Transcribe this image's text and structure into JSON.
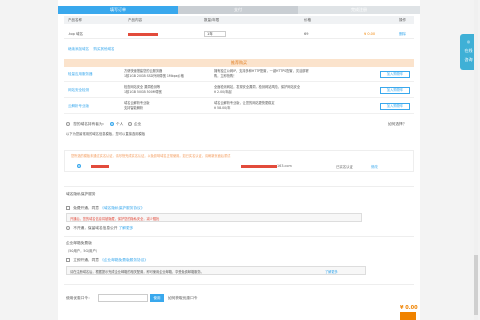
{
  "steps": [
    "填写订单",
    "支付",
    "完成注册"
  ],
  "table": {
    "headers": [
      "产品名称",
      "产品内容",
      "数量/年限",
      "价格",
      "操作"
    ],
    "row": {
      "name": ".top 域名",
      "years": "1年",
      "price": "¥ 0.00",
      "old_price": "69",
      "delete": "删除"
    }
  },
  "links": {
    "left": "继续添加域名",
    "right": "购买其他域名"
  },
  "recommend": {
    "title": "推荐购买",
    "items": [
      {
        "name": "轻量应用服务器",
        "desc1": "方便快速搭建您的云服务器",
        "desc2": "1核1GB 20GB SSD外网带宽 1Mbps价格",
        "desc3": "拥有独立公网IP，支持多种HTTP配置，一键HTTPS配置，灵活部署",
        "desc4": "购，立即抢购！",
        "btn": "加入购物车"
      },
      {
        "name": "网站安全检测",
        "desc1": "检查网站安全 漏洞检测等",
        "desc2": "1核1GB 50GB 500M带宽",
        "desc3": "全面检测网站，发现安全漏洞，检测网站风险，保护网站安全",
        "desc4": "¥ 2.00/年起",
        "btn": "加入购物车"
      },
      {
        "name": "云解析专业版",
        "desc1": "域名云解析专业版",
        "desc2": "支持智能解析",
        "desc3": "域名云解析专业版，让您的网站更快更稳定",
        "desc4": "¥ 58.00/年",
        "btn": "加入购物车"
      }
    ]
  },
  "owner": {
    "label": "您的域名持有者为：",
    "person": "个人",
    "company": "企业",
    "help": "如何选择？",
    "hint": "以下为您最常用的域名信息模板，您可以直接选用模板"
  },
  "notice": {
    "warn": "您所选的模板未通过实名认证，请尽快完成实名认证，以免影响域名正常使用。如已实名认证，请刷新页面后重试",
    "domain": "163.com",
    "status": "已实名认证",
    "action": "修改"
  },
  "privacy": {
    "title": "域名隐私保护服务",
    "option1_pre": "免费开通，同意",
    "option1_link": "《域名隐私保护服务协议》",
    "option1_desc": "开通后，您的域名信息将被隐藏，保护您的隐私安全，减少骚扰",
    "option2": "不开通，保留域名信息公开",
    "learn_more": "了解更多"
  },
  "email": {
    "title": "企业邮箱免费版",
    "sub": "（50用户，5G/用户）",
    "option_pre": "立即开通，同意",
    "option_link": "《企业邮箱免费版服务协议》",
    "desc": "请在注册域名后，根据提示完成企业邮箱的相关配置，即可使用企业邮箱，享受免费邮箱服务。",
    "learn_more": "了解更多"
  },
  "coupon": {
    "label": "使用优惠口令：",
    "btn": "使用",
    "link": "如何获取优惠口令"
  },
  "sidebar": {
    "lines": [
      "在线",
      "咨询"
    ]
  },
  "bottom": {
    "price": "¥ 0.00"
  }
}
